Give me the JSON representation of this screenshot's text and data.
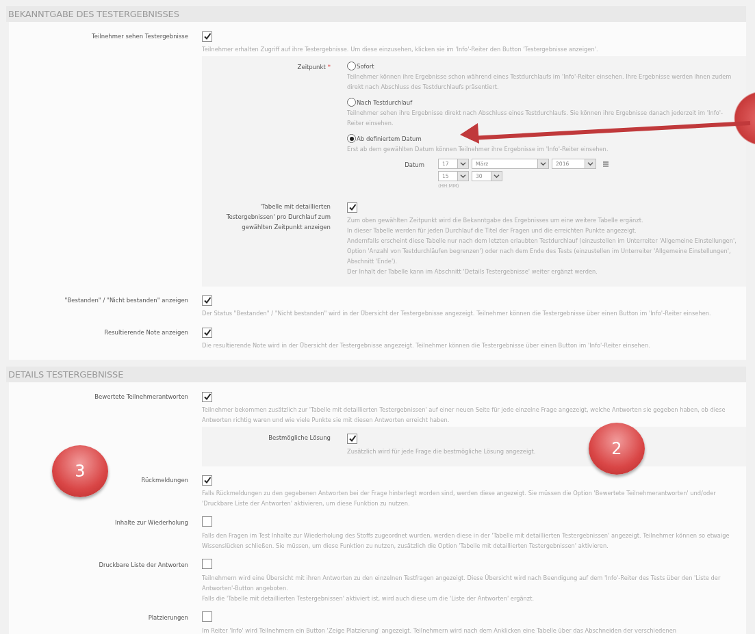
{
  "sections": [
    {
      "title": "BEKANNTGABE DES TESTERGEBNISSES",
      "fields": [
        {
          "kind": "checkbox",
          "label": "Teilnehmer sehen Testergebnisse",
          "checked": true,
          "description": [
            "Teilnehmer erhalten Zugriff auf ihre Testergebnisse. Um diese einzusehen, klicken sie im 'Info'-Reiter den Button 'Testergebnisse anzeigen'."
          ],
          "subpanel": [
            {
              "kind": "radio",
              "label": "Zeitpunkt",
              "required_mark": "*",
              "options": [
                {
                  "label": "Sofort",
                  "selected": false,
                  "description": [
                    "Teilnehmer können ihre Ergebnisse schon während eines Testdurchlaufs im 'Info'-Reiter einsehen. Ihre Ergebnisse werden ihnen zudem direkt nach Abschluss des Testdurchlaufs präsentiert."
                  ]
                },
                {
                  "label": "Nach Testdurchlauf",
                  "selected": false,
                  "description": [
                    "Teilnehmer sehen ihre Ergebnisse direkt nach Abschluss eines Testdurchlaufs. Sie können ihre Ergebnisse danach jederzeit im 'Info'-Reiter einsehen."
                  ]
                },
                {
                  "label": "Ab definiertem Datum",
                  "selected": true,
                  "description": [
                    "Erst ab dem gewählten Datum können Teilnehmer ihre Ergebnisse im 'Info'-Reiter einsehen."
                  ],
                  "date": {
                    "label": "Datum",
                    "day": "17",
                    "month": "März",
                    "year": "2016",
                    "hour": "15",
                    "minute": "30",
                    "hint": "(HH:MM)"
                  }
                }
              ]
            },
            {
              "kind": "checkbox",
              "label": "'Tabelle mit detaillierten Testergebnissen' pro Durchlauf zum gewählten Zeitpunkt anzeigen",
              "checked": true,
              "description": [
                "Zum oben gewählten Zeitpunkt wird die Bekanntgabe des Ergebnisses um eine weitere Tabelle ergänzt.",
                "In dieser Tabelle werden für jeden Durchlauf die Titel der Fragen und die erreichten Punkte angezeigt.",
                "Andernfalls erscheint diese Tabelle nur nach dem letzten erlaubten Testdurchlauf (einzustellen im Unterreiter 'Allgemeine Einstellungen', Option 'Anzahl von Testdurchläufen begrenzen') oder nach dem Ende des Tests (einzustellen im Unterreiter 'Allgemeine Einstellungen', Abschnitt 'Ende').",
                "Der Inhalt der Tabelle kann im Abschnitt 'Details Testergebnisse' weiter ergänzt werden."
              ]
            }
          ]
        },
        {
          "kind": "checkbox",
          "label": "\"Bestanden\" / \"Nicht bestanden\" anzeigen",
          "checked": true,
          "description": [
            "Der Status \"Bestanden\" / \"Nicht bestanden\" wird in der Übersicht der Testergebnisse angezeigt. Teilnehmer können die Testergebnisse über einen Button im 'Info'-Reiter einsehen."
          ]
        },
        {
          "kind": "checkbox",
          "label": "Resultierende Note anzeigen",
          "checked": true,
          "description": [
            "Die resultierende Note wird in der Übersicht der Testergebnisse angezeigt. Teilnehmer können die Testergebnisse über einen Button im 'Info'-Reiter einsehen."
          ]
        }
      ]
    },
    {
      "title": "DETAILS TESTERGEBNISSE",
      "fields": [
        {
          "kind": "checkbox",
          "label": "Bewertete Teilnehmerantworten",
          "checked": true,
          "description": [
            "Teilnehmer bekommen zusätzlich zur 'Tabelle mit detaillierten Testergebnissen' auf einer neuen Seite für jede einzelne Frage angezeigt, welche Antworten sie gegeben haben, ob diese Antworten richtig waren und wie viele Punkte sie mit diesen Antworten erreicht haben."
          ],
          "subpanel": [
            {
              "kind": "checkbox",
              "label": "Bestmögliche Lösung",
              "checked": true,
              "description": [
                "Zusätzlich wird für jede Frage die bestmögliche Lösung angezeigt."
              ]
            }
          ]
        },
        {
          "kind": "checkbox",
          "label": "Rückmeldungen",
          "checked": true,
          "description": [
            "Falls Rückmeldungen zu den gegebenen Antworten bei der Frage hinterlegt worden sind, werden diese angezeigt. Sie müssen die Option 'Bewertete Teilnehmerantworten' und/oder 'Druckbare Liste der Antworten' aktivieren, um diese Funktion zu nutzen."
          ]
        },
        {
          "kind": "checkbox",
          "label": "Inhalte zur Wiederholung",
          "checked": false,
          "description": [
            "Falls den Fragen im Test Inhalte zur Wiederholung des Stoffs zugeordnet wurden, werden diese in der 'Tabelle mit detaillierten Testergebnissen' angezeigt. Teilnehmer können so etwaige Wissenslücken schließen. Sie müssen, um diese Funktion zu nutzen, zusätzlich die Option 'Tabelle mit detaillierten Testergebnissen' aktivieren."
          ]
        },
        {
          "kind": "checkbox",
          "label": "Druckbare Liste der Antworten",
          "checked": false,
          "description": [
            "Teilnehmern wird eine Übersicht mit ihren Antworten zu den einzelnen Testfragen angezeigt. Diese Übersicht wird nach Beendigung auf dem 'Info'-Reiter des Tests über den 'Liste der Antworten'-Button angeboten.",
            "Falls die 'Tabelle mit detaillierten Testergebnissen' aktiviert ist, wird auch diese um die 'Liste der Antworten' ergänzt."
          ]
        },
        {
          "kind": "checkbox",
          "label": "Platzierungen",
          "checked": false,
          "description": [
            "Im Reiter 'Info' wird Teilnehmern ein Button 'Zeige Platzierung' angezeigt. Teilnehmern wird nach dem Anklicken eine Tabelle über das Abschneiden der verschiedenen"
          ]
        }
      ]
    }
  ],
  "annotations": [
    {
      "kind": "badge"
    },
    {
      "kind": "arrow"
    },
    {
      "kind": "badge",
      "label": "2"
    },
    {
      "kind": "badge",
      "label": "3"
    }
  ]
}
